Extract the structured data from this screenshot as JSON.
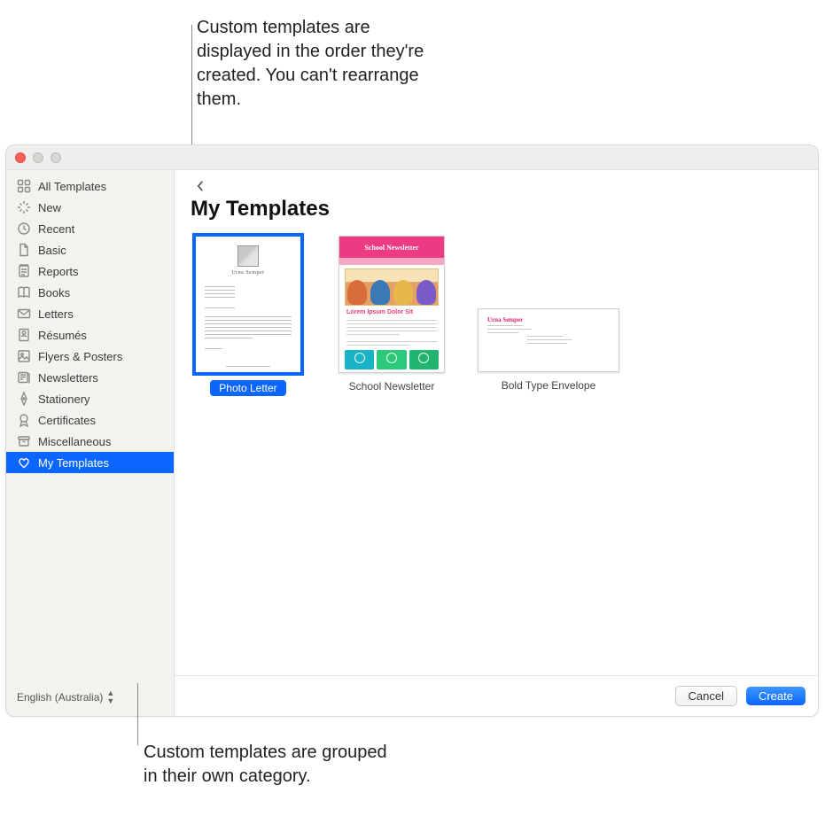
{
  "callouts": {
    "top": "Custom templates are displayed in the order they're created. You can't rearrange them.",
    "bottom": "Custom templates are grouped in their own category."
  },
  "sidebar": {
    "items": [
      "All Templates",
      "New",
      "Recent",
      "Basic",
      "Reports",
      "Books",
      "Letters",
      "Résumés",
      "Flyers & Posters",
      "Newsletters",
      "Stationery",
      "Certificates",
      "Miscellaneous",
      "My Templates"
    ],
    "selected_index": 13,
    "language": "English (Australia)"
  },
  "main": {
    "title": "My Templates",
    "templates": [
      {
        "label": "Photo Letter",
        "selected": true
      },
      {
        "label": "School Newsletter",
        "selected": false,
        "newsletter_title": "School Newsletter",
        "sub_heading": "Lorem Ipsum Dolor Sit"
      },
      {
        "label": "Bold Type Envelope",
        "selected": false,
        "sender": "Urna Semper"
      }
    ]
  },
  "footer": {
    "cancel": "Cancel",
    "create": "Create"
  }
}
